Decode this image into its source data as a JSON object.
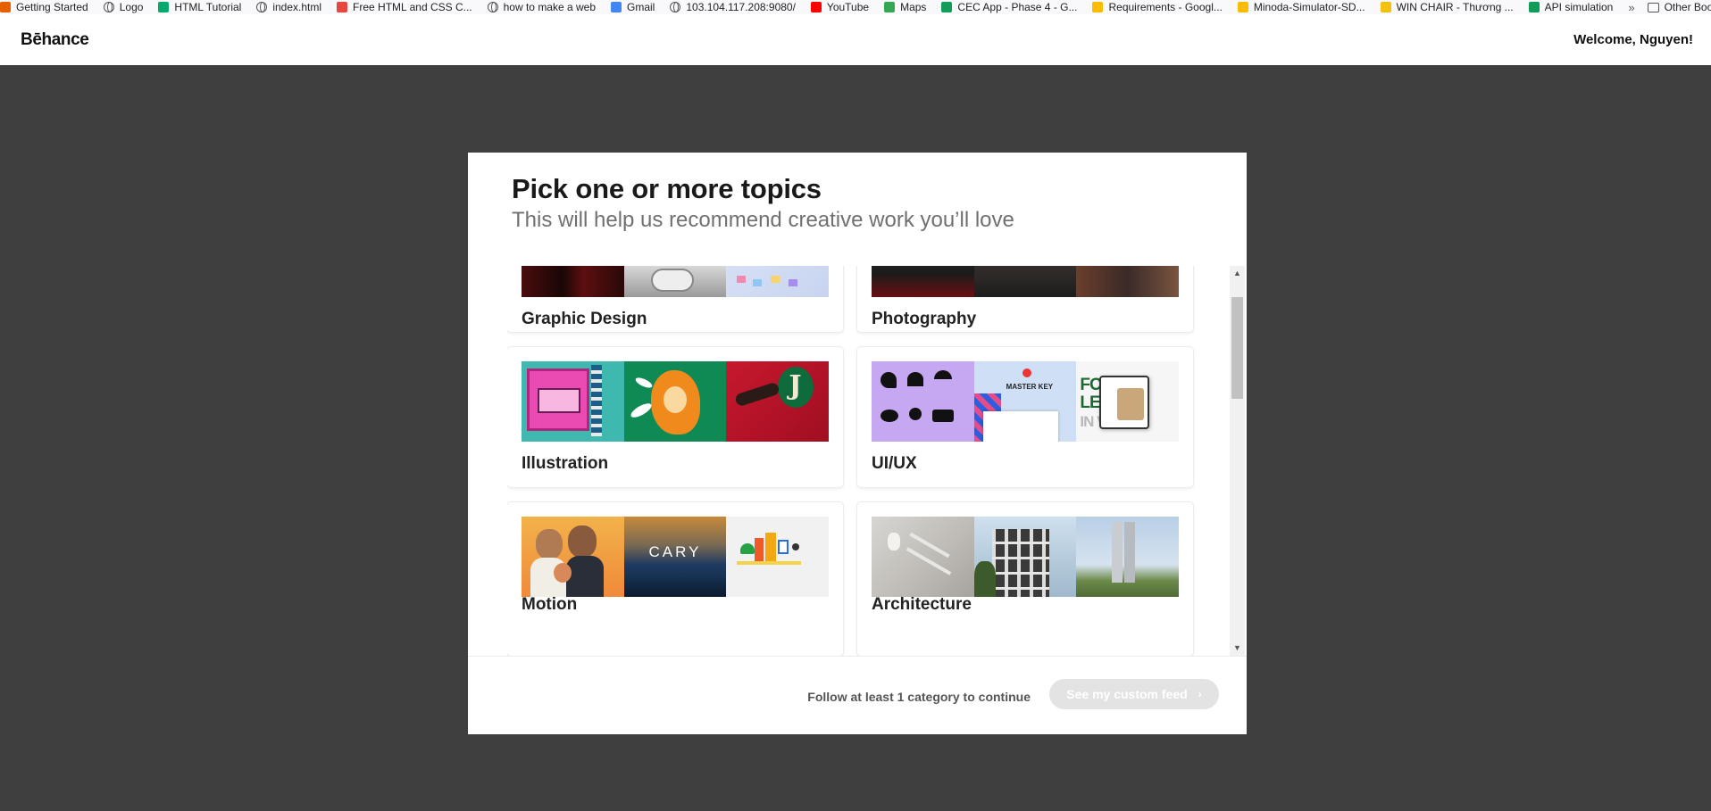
{
  "bookmarks": {
    "items": [
      {
        "label": "Getting Started",
        "icon": "firefox-icon",
        "color": "#e66000"
      },
      {
        "label": "Logo",
        "icon": "globe-icon"
      },
      {
        "label": "HTML Tutorial",
        "icon": "w3schools-icon",
        "color": "#04aa6d"
      },
      {
        "label": "index.html",
        "icon": "globe-icon"
      },
      {
        "label": "Free HTML and CSS C...",
        "icon": "bookmark-red-icon",
        "color": "#e8453c"
      },
      {
        "label": "how to make a web",
        "icon": "globe-icon"
      },
      {
        "label": "Gmail",
        "icon": "google-icon",
        "color": "#4285f4"
      },
      {
        "label": "103.104.117.208:9080/",
        "icon": "globe-icon"
      },
      {
        "label": "YouTube",
        "icon": "youtube-icon",
        "color": "#ff0000"
      },
      {
        "label": "Maps",
        "icon": "maps-icon",
        "color": "#34a853"
      },
      {
        "label": "CEC App - Phase 4 - G...",
        "icon": "sheets-icon",
        "color": "#0f9d58"
      },
      {
        "label": "Requirements - Googl...",
        "icon": "drive-icon",
        "color": "#fbbc04"
      },
      {
        "label": "Minoda-Simulator-SD...",
        "icon": "drive-icon",
        "color": "#fbbc04"
      },
      {
        "label": "WIN CHAIR - Thương ...",
        "icon": "crown-icon",
        "color": "#f4c20d"
      },
      {
        "label": "API simulation",
        "icon": "sheets-icon",
        "color": "#0f9d58"
      }
    ],
    "overflow": "»",
    "other": "Other Bookmarks"
  },
  "header": {
    "logo": "Bēhance",
    "welcome": "Welcome, Nguyen!"
  },
  "modal": {
    "title": "Pick one or more topics",
    "subtitle": "This will help us recommend creative work you’ll love",
    "categories": [
      {
        "label": "Graphic Design"
      },
      {
        "label": "Photography"
      },
      {
        "label": "Illustration"
      },
      {
        "label": "UI/UX"
      },
      {
        "label": "Motion"
      },
      {
        "label": "Architecture"
      }
    ],
    "footer_note": "Follow at least 1 category to continue",
    "cta_label": "See my custom feed",
    "cta_icon": "chevron-right-icon"
  },
  "thumb_texts": {
    "cary": "CARY",
    "master_key": "MASTER KEY",
    "forest": "FOREST",
    "letty": "LETTY",
    "ive": "IN  VE"
  }
}
